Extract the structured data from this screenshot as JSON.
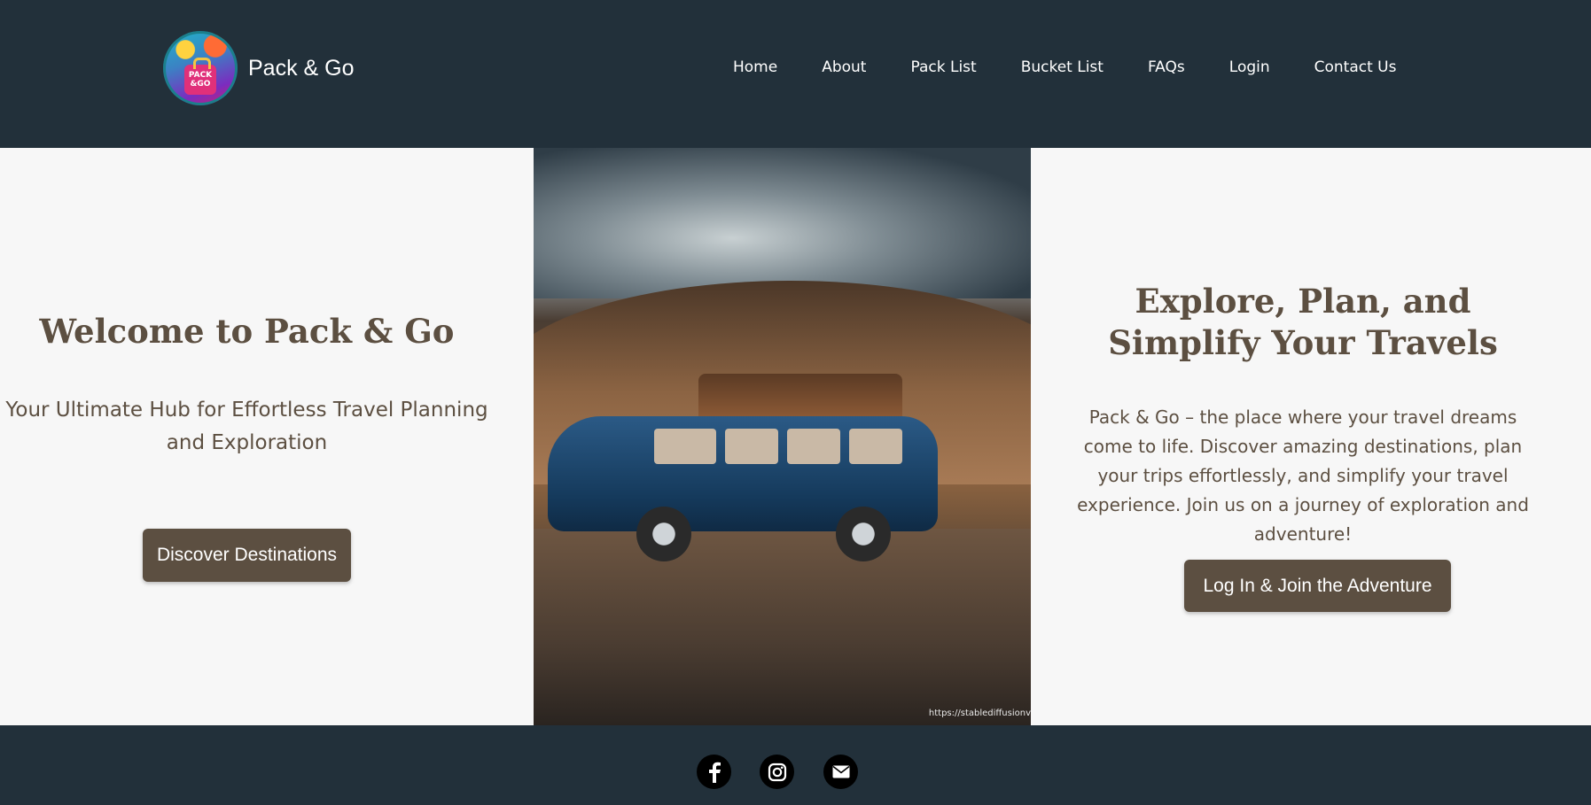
{
  "header": {
    "brand_name": "Pack & Go",
    "logo_text_line1": "PACK",
    "logo_text_line2": "&GO",
    "nav": [
      "Home",
      "About",
      "Pack List",
      "Bucket List",
      "FAQs",
      "Login",
      "Contact Us"
    ]
  },
  "left": {
    "title": "Welcome to Pack & Go",
    "subtitle": "Your Ultimate Hub for Effortless Travel Planning and Exploration",
    "button": "Discover Destinations"
  },
  "hero": {
    "credit": "https://stablediffusionv"
  },
  "right": {
    "title": "Explore, Plan, and Simplify Your Travels",
    "body": "Pack & Go – the place where your travel dreams come to life. Discover amazing destinations, plan your trips effortlessly, and simplify your travel experience. Join us on a journey of exploration and adventure!",
    "button": "Log In & Join the Adventure"
  },
  "footer": {
    "icons": [
      "facebook-icon",
      "instagram-icon",
      "email-icon"
    ]
  },
  "colors": {
    "header_bg": "#22303a",
    "content_bg": "#f7f7f7",
    "accent_brown": "#5c4f41"
  }
}
